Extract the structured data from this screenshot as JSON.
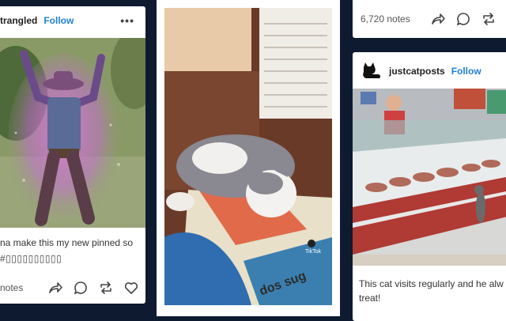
{
  "left_post": {
    "username": "trangled",
    "follow": "Follow",
    "more": "•••",
    "caption": "na make this my new pinned so",
    "tags": "#▯▯▯▯▯▯▯▯▯▯",
    "notes": "notes"
  },
  "middle_post": {
    "sign_text": "dos sug",
    "watermark": "TikTok"
  },
  "right_top_post": {
    "notes": "6,720 notes"
  },
  "right_post": {
    "username": "justcatposts",
    "follow": "Follow",
    "caption": "This cat visits regularly and he alw has a treat!"
  }
}
